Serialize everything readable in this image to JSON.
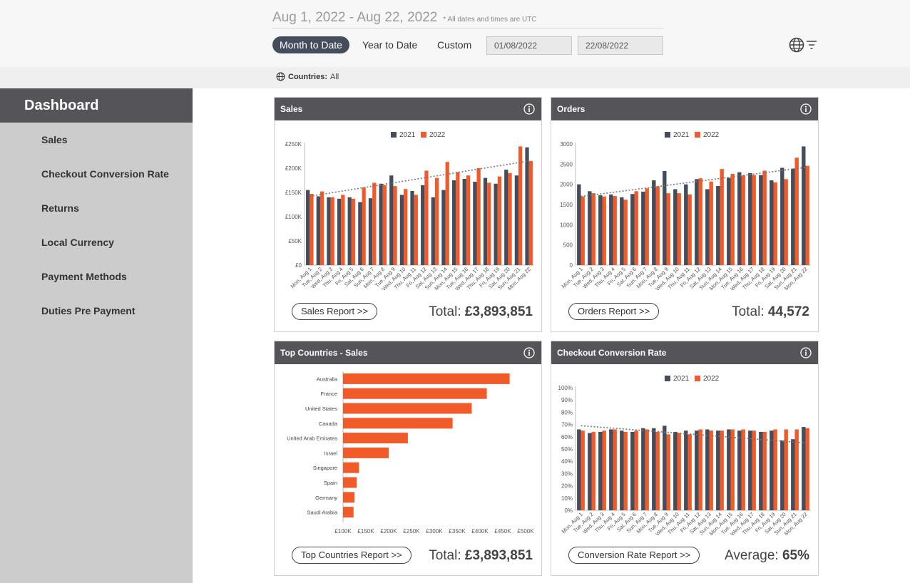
{
  "header": {
    "date_range": "Aug 1, 2022 - Aug 22, 2022",
    "utc_note": "* All dates and times are UTC",
    "presets": [
      "Month to Date",
      "Year to Date",
      "Custom"
    ],
    "active_preset": "Month to Date",
    "start_date": "01/08/2022",
    "end_date": "22/08/2022",
    "globe_icon": "globe-icon",
    "filter_icon": "filter-icon"
  },
  "countries_filter": {
    "label": "Countries:",
    "value": "All"
  },
  "sidebar": {
    "title": "Dashboard",
    "items": [
      {
        "label": "Sales"
      },
      {
        "label": "Checkout Conversion Rate"
      },
      {
        "label": "Returns"
      },
      {
        "label": "Local Currency"
      },
      {
        "label": "Payment Methods"
      },
      {
        "label": "Duties Pre Payment"
      }
    ]
  },
  "colors": {
    "series_2021": "#454d5c",
    "series_2022": "#f15a29",
    "header": "#545459",
    "trend": "#777777"
  },
  "cards": {
    "sales": {
      "title": "Sales",
      "button": "Sales Report >>",
      "total_label": "Total:",
      "total_value": "£3,893,851"
    },
    "orders": {
      "title": "Orders",
      "button": "Orders Report >>",
      "total_label": "Total:",
      "total_value": "44,572"
    },
    "top_countries": {
      "title": "Top Countries - Sales",
      "button": "Top Countries Report >>",
      "total_label": "Total:",
      "total_value": "£3,893,851"
    },
    "conversion": {
      "title": "Checkout Conversion Rate",
      "button": "Conversion Rate Report >>",
      "total_label": "Average:",
      "total_value": "65%"
    }
  },
  "chart_data": [
    {
      "id": "sales",
      "type": "bar",
      "title": "Sales",
      "legend": [
        "2021",
        "2022"
      ],
      "legend_position": "top",
      "categories": [
        "Mon, Aug 1",
        "Tue, Aug 2",
        "Wed, Aug 3",
        "Thu, Aug 4",
        "Fri, Aug 5",
        "Sat, Aug 6",
        "Sun, Aug 7",
        "Mon, Aug 8",
        "Tue, Aug 9",
        "Wed, Aug 10",
        "Thu, Aug 11",
        "Fri, Aug 12",
        "Sat, Aug 13",
        "Sun, Aug 14",
        "Mon, Aug 15",
        "Tue, Aug 16",
        "Wed, Aug 17",
        "Thu, Aug 18",
        "Fri, Aug 19",
        "Sat, Aug 20",
        "Sun, Aug 21",
        "Mon, Aug 22"
      ],
      "series": [
        {
          "name": "2021",
          "values": [
            155,
            142,
            140,
            137,
            140,
            130,
            138,
            168,
            185,
            145,
            153,
            165,
            140,
            155,
            175,
            178,
            172,
            180,
            168,
            197,
            185,
            243
          ]
        },
        {
          "name": "2022",
          "values": [
            147,
            152,
            140,
            145,
            137,
            160,
            170,
            165,
            163,
            157,
            145,
            195,
            180,
            213,
            192,
            185,
            200,
            170,
            183,
            190,
            245,
            215
          ]
        }
      ],
      "trend": {
        "start": 142,
        "end": 215
      },
      "ylim": [
        0,
        250
      ],
      "yticks": [
        "£0",
        "£50K",
        "£100K",
        "£150K",
        "£200K",
        "£250K"
      ],
      "ytick_values": [
        0,
        50,
        100,
        150,
        200,
        250
      ],
      "unit": "thousands GBP"
    },
    {
      "id": "orders",
      "type": "bar",
      "title": "Orders",
      "legend": [
        "2021",
        "2022"
      ],
      "legend_position": "top",
      "categories": [
        "Mon, Aug 1",
        "Tue, Aug 2",
        "Wed, Aug 3",
        "Thu, Aug 4",
        "Fri, Aug 5",
        "Sat, Aug 6",
        "Sun, Aug 7",
        "Mon, Aug 8",
        "Tue, Aug 9",
        "Wed, Aug 10",
        "Thu, Aug 11",
        "Fri, Aug 12",
        "Sat, Aug 13",
        "Sun, Aug 14",
        "Mon, Aug 15",
        "Tue, Aug 16",
        "Wed, Aug 17",
        "Thu, Aug 18",
        "Fri, Aug 19",
        "Sat, Aug 20",
        "Sun, Aug 21",
        "Mon, Aug 22"
      ],
      "series": [
        {
          "name": "2021",
          "values": [
            2000,
            1830,
            1730,
            1750,
            1680,
            1760,
            1820,
            2100,
            2330,
            1880,
            2000,
            2130,
            1880,
            1960,
            2160,
            2300,
            2280,
            2230,
            2100,
            2410,
            2390,
            2940
          ]
        },
        {
          "name": "2022",
          "values": [
            1700,
            1780,
            1700,
            1710,
            1620,
            1830,
            1900,
            1950,
            1780,
            1780,
            1750,
            2150,
            2070,
            2380,
            2260,
            2220,
            2230,
            2340,
            2050,
            2130,
            2660,
            2460
          ]
        }
      ],
      "trend": {
        "start": 1700,
        "end": 2420
      },
      "ylim": [
        0,
        3000
      ],
      "yticks": [
        "0",
        "500",
        "1000",
        "1500",
        "2000",
        "2500",
        "3000"
      ],
      "ytick_values": [
        0,
        500,
        1000,
        1500,
        2000,
        2500,
        3000
      ]
    },
    {
      "id": "top_countries",
      "type": "bar",
      "orientation": "horizontal",
      "title": "Top Countries - Sales",
      "categories": [
        "Australia",
        "France",
        "United States",
        "Canada",
        "United Arab Emirates",
        "Israel",
        "Singapore",
        "Spain",
        "Germany",
        "Saudi Arabia"
      ],
      "values": [
        465,
        415,
        382,
        340,
        242,
        200,
        135,
        130,
        125,
        123
      ],
      "xlim": [
        100,
        500
      ],
      "xticks": [
        "£100K",
        "£150K",
        "£200K",
        "£250K",
        "£300K",
        "£350K",
        "£400K",
        "£450K",
        "£500K"
      ],
      "xtick_values": [
        100,
        150,
        200,
        250,
        300,
        350,
        400,
        450,
        500
      ],
      "unit": "thousands GBP"
    },
    {
      "id": "conversion",
      "type": "bar",
      "title": "Checkout Conversion Rate",
      "legend": [
        "2021",
        "2022"
      ],
      "legend_position": "top",
      "categories": [
        "Mon, Aug 1",
        "Tue, Aug 2",
        "Wed, Aug 3",
        "Thu, Aug 4",
        "Fri, Aug 5",
        "Sat, Aug 6",
        "Sun, Aug 7",
        "Mon, Aug 8",
        "Tue, Aug 9",
        "Wed, Aug 10",
        "Thu, Aug 11",
        "Fri, Aug 12",
        "Sat, Aug 13",
        "Sun, Aug 14",
        "Mon, Aug 15",
        "Tue, Aug 16",
        "Wed, Aug 17",
        "Thu, Aug 18",
        "Fri, Aug 19",
        "Sat, Aug 20",
        "Sun, Aug 21",
        "Mon, Aug 22"
      ],
      "series": [
        {
          "name": "2021",
          "values": [
            66,
            63,
            64,
            66,
            65,
            64,
            67,
            67,
            69,
            64,
            65,
            65,
            66,
            65,
            66,
            65,
            65,
            64,
            65,
            57,
            58,
            68
          ]
        },
        {
          "name": "2022",
          "values": [
            65,
            64,
            65,
            66,
            64,
            65,
            66,
            64,
            62,
            63,
            62,
            66,
            65,
            65,
            66,
            66,
            65,
            64,
            66,
            66,
            66,
            67
          ]
        }
      ],
      "trend": {
        "start": 69,
        "end": 55
      },
      "ylim": [
        0,
        100
      ],
      "yticks": [
        "0%",
        "10%",
        "20%",
        "30%",
        "40%",
        "50%",
        "60%",
        "70%",
        "80%",
        "90%",
        "100%"
      ],
      "ytick_values": [
        0,
        10,
        20,
        30,
        40,
        50,
        60,
        70,
        80,
        90,
        100
      ]
    }
  ]
}
